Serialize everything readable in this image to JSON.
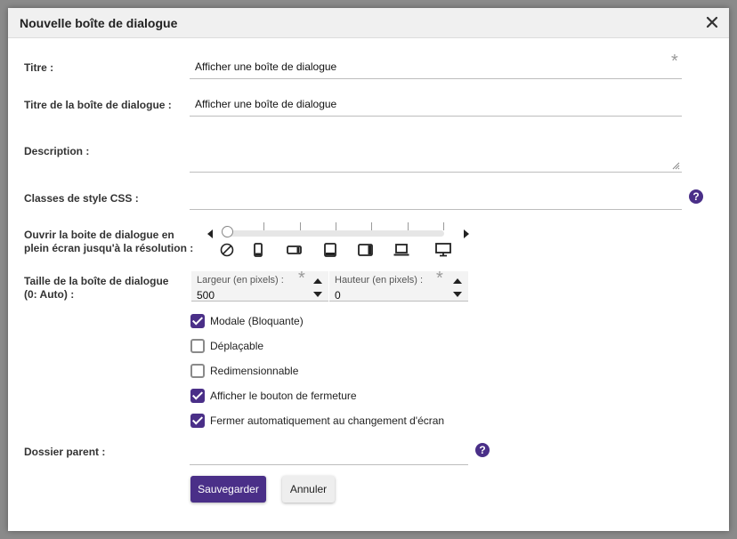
{
  "dialog": {
    "title": "Nouvelle boîte de dialogue"
  },
  "form": {
    "titre": {
      "label": "Titre :",
      "value": "Afficher une boîte de dialogue"
    },
    "titre_dialogue": {
      "label": "Titre de la boîte de dialogue :",
      "value": "Afficher une boîte de dialogue"
    },
    "description": {
      "label": "Description :",
      "value": ""
    },
    "classes_css": {
      "label": "Classes de style CSS :",
      "value": ""
    },
    "plein_ecran": {
      "label_line1": "Ouvrir la boite de dialogue en",
      "label_line2": "plein écran jusqu'à la résolution :",
      "devices": [
        "none-icon",
        "phone-portrait-icon",
        "phone-landscape-icon",
        "tablet-portrait-icon",
        "tablet-landscape-icon",
        "laptop-icon",
        "desktop-icon"
      ],
      "selected_index": 0
    },
    "taille": {
      "label_line1": "Taille de la boîte de dialogue",
      "label_line2": "(0: Auto) :",
      "largeur_label": "Largeur (en pixels) :",
      "largeur_value": "500",
      "hauteur_label": "Hauteur (en pixels) :",
      "hauteur_value": "0"
    },
    "options": [
      {
        "label": "Modale (Bloquante)",
        "checked": true
      },
      {
        "label": "Déplaçable",
        "checked": false
      },
      {
        "label": "Redimensionnable",
        "checked": false
      },
      {
        "label": "Afficher le bouton de fermeture",
        "checked": true
      },
      {
        "label": "Fermer automatiquement au changement d'écran",
        "checked": true
      }
    ],
    "dossier_parent": {
      "label": "Dossier parent :",
      "value": ""
    }
  },
  "buttons": {
    "save": "Sauvegarder",
    "cancel": "Annuler"
  },
  "colors": {
    "accent": "#4a2f88"
  }
}
